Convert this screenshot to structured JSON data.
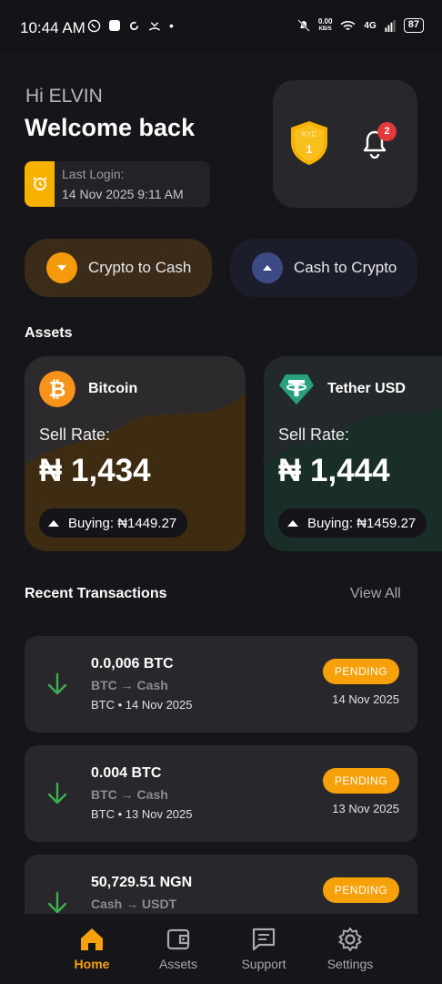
{
  "status_bar": {
    "time": "10:44 AM",
    "data_rate": "0.00",
    "data_unit": "KB/S",
    "network": "4G",
    "battery": "87"
  },
  "header": {
    "greeting": "Hi ELVIN",
    "title": "Welcome back",
    "last_login_label": "Last Login:",
    "last_login_value": "14 Nov 2025 9:11 AM",
    "kyc_label": "KYC",
    "kyc_level": "1",
    "notification_count": "2"
  },
  "actions": [
    {
      "label": "Crypto to Cash"
    },
    {
      "label": "Cash to Crypto"
    }
  ],
  "assets": {
    "title": "Assets",
    "cards": [
      {
        "name": "Bitcoin",
        "sell_label": "Sell Rate:",
        "sell_rate": "₦ 1,434",
        "buying": "Buying: ₦1449.27",
        "color": "#f7931a"
      },
      {
        "name": "Tether USD",
        "sell_label": "Sell Rate:",
        "sell_rate": "₦ 1,444",
        "buying": "Buying: ₦1459.27",
        "color": "#26a17b"
      }
    ]
  },
  "transactions": {
    "title": "Recent Transactions",
    "view_all": "View All",
    "items": [
      {
        "amount": "0.0,006 BTC",
        "pair": "BTC → Cash",
        "meta": "BTC • 14 Nov 2025",
        "status": "PENDING",
        "date": "14 Nov 2025"
      },
      {
        "amount": "0.004 BTC",
        "pair": "BTC → Cash",
        "meta": "BTC • 13 Nov 2025",
        "status": "PENDING",
        "date": "13 Nov 2025"
      },
      {
        "amount": "50,729.51 NGN",
        "pair": "Cash → USDT",
        "meta": "",
        "status": "PENDING",
        "date": ""
      }
    ]
  },
  "nav": [
    {
      "label": "Home",
      "icon": "home-icon",
      "active": true
    },
    {
      "label": "Assets",
      "icon": "wallet-icon",
      "active": false
    },
    {
      "label": "Support",
      "icon": "chat-icon",
      "active": false
    },
    {
      "label": "Settings",
      "icon": "gear-icon",
      "active": false
    }
  ],
  "colors": {
    "accent": "#f7a10a",
    "background": "#16151a",
    "card": "#28272c",
    "success": "#3fae4f"
  }
}
